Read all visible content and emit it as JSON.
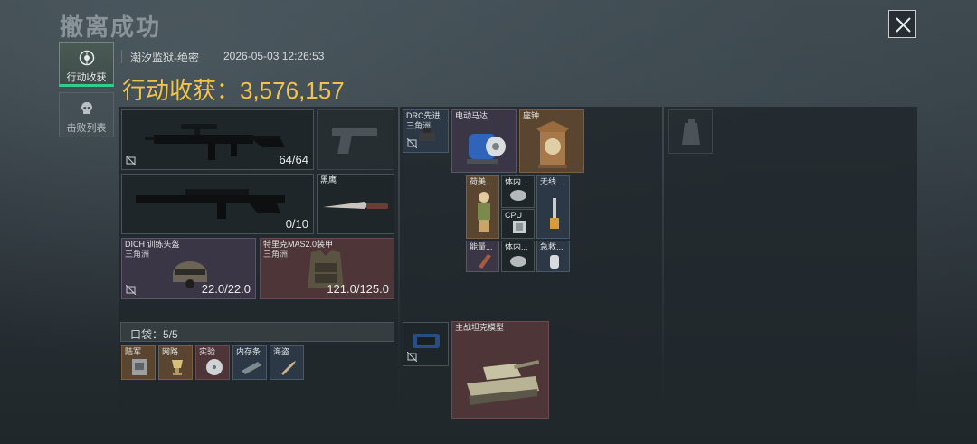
{
  "header": {
    "title": "撤离成功",
    "close_label": "close"
  },
  "sidebar": {
    "tabs": [
      {
        "label": "行动收获",
        "active": true
      },
      {
        "label": "击败列表",
        "active": false
      }
    ]
  },
  "raid": {
    "map": "潮汐监狱-绝密",
    "datetime": "2026-05-03 12:26:53",
    "total_label": "行动收获：3,576,157"
  },
  "loadout": {
    "primary_weapon": {
      "name": "",
      "value": "64/64"
    },
    "pistol": {
      "name": ""
    },
    "secondary_weapon": {
      "name": "",
      "value": "0/10"
    },
    "melee": {
      "name": "黑鹰"
    },
    "helmet": {
      "name": "DICH 训练头盔",
      "sub": "三角洲",
      "value": "22.0/22.0"
    },
    "armor": {
      "name": "特里克MAS2.0装甲",
      "sub": "三角洲",
      "value": "121.0/125.0"
    }
  },
  "pocket": {
    "label": "口袋：",
    "count": "5/5",
    "items": [
      {
        "name": "陆军"
      },
      {
        "name": "网路"
      },
      {
        "name": "实验"
      },
      {
        "name": "内存条"
      },
      {
        "name": "海盗"
      }
    ]
  },
  "backpack": {
    "items": [
      {
        "name": "DRC先进...",
        "sub": "三角洲"
      },
      {
        "name": "电动马达"
      },
      {
        "name": "座钟"
      },
      {
        "name": "荷美..."
      },
      {
        "name": "体内..."
      },
      {
        "name": "无线..."
      },
      {
        "name": "CPU"
      },
      {
        "name": "能量..."
      },
      {
        "name": "体内..."
      },
      {
        "name": "急救..."
      },
      {
        "name": ""
      },
      {
        "name": "主战坦克模型"
      }
    ]
  },
  "colors": {
    "accent": "#f0c44a",
    "active_tab": "#2fcf8a"
  }
}
